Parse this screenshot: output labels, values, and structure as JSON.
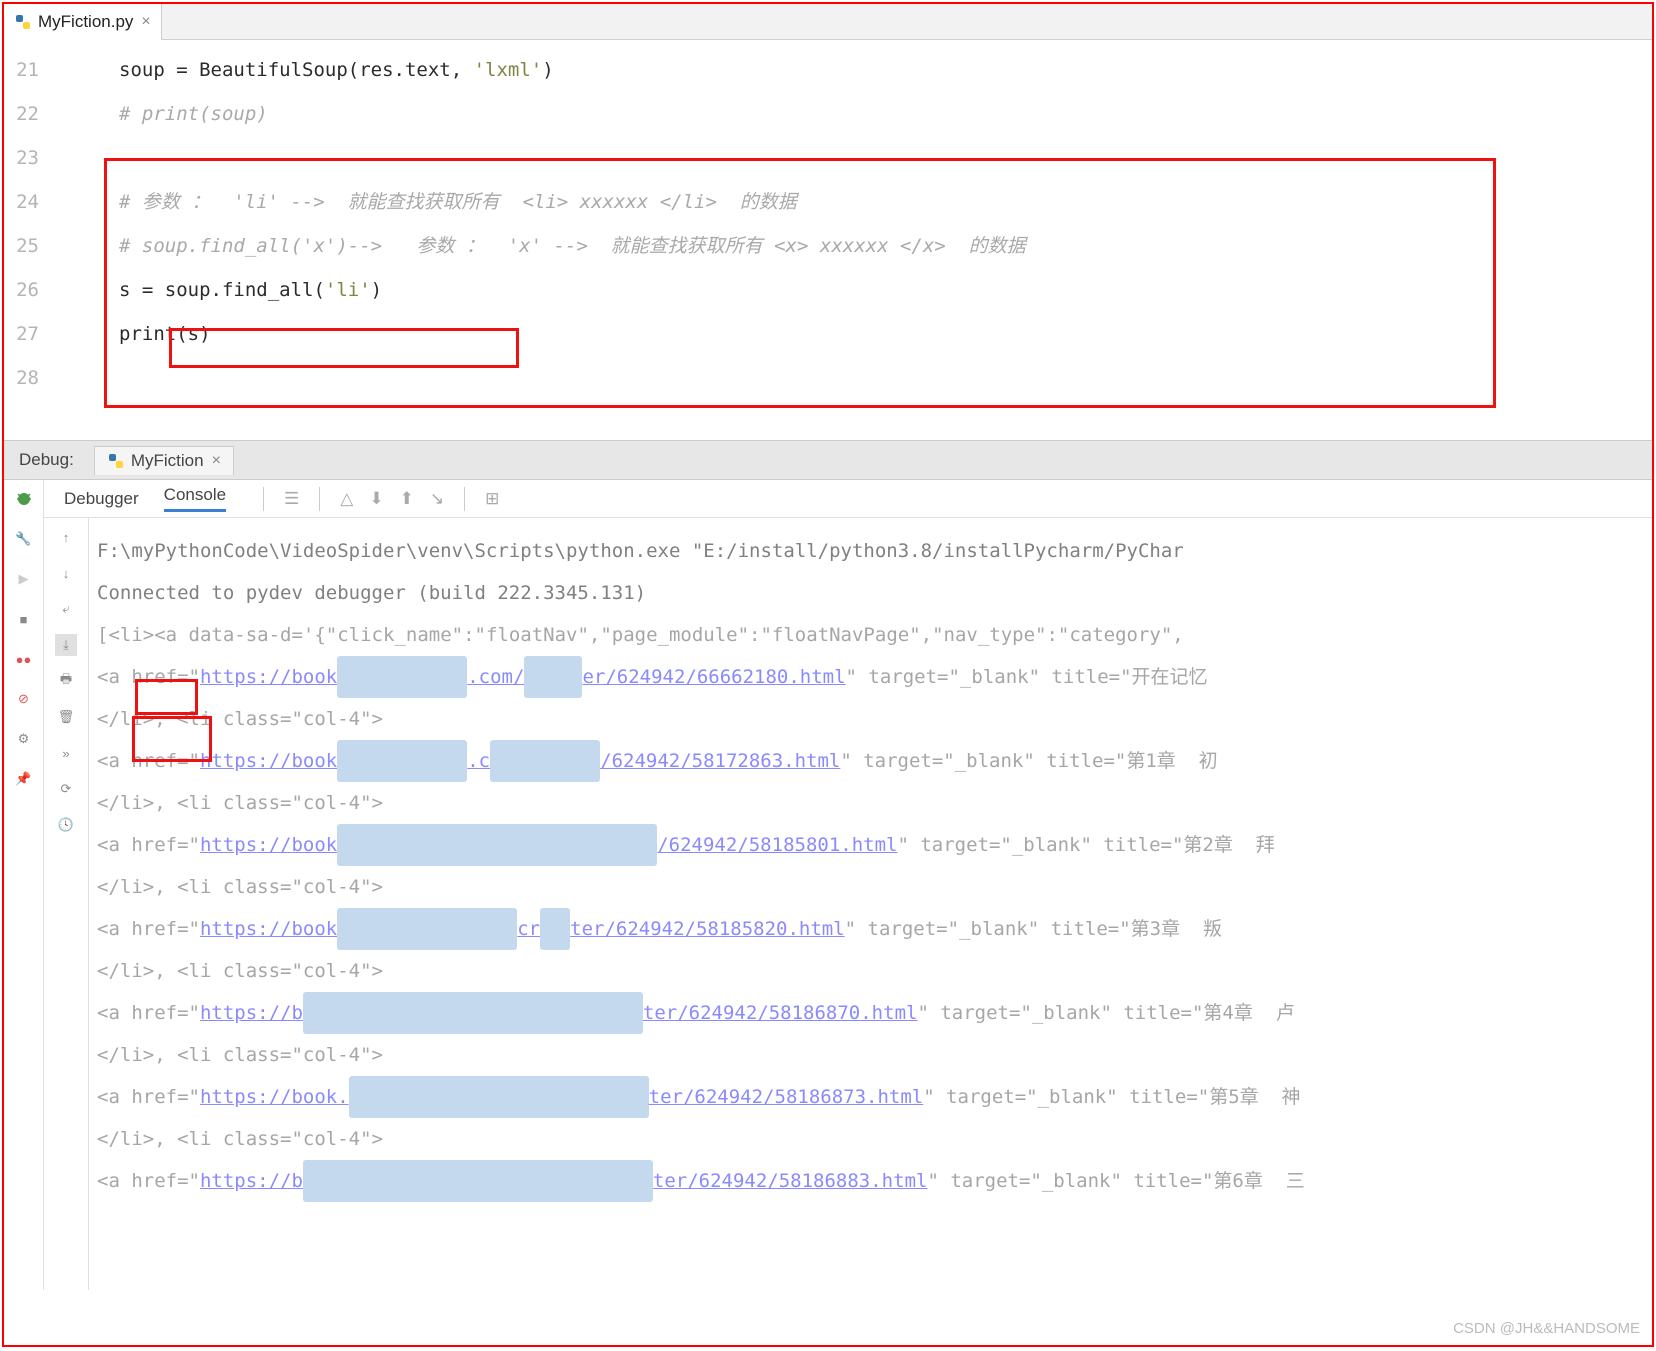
{
  "file_tab": {
    "name": "MyFiction.py"
  },
  "gutter": [
    "21",
    "22",
    "23",
    "24",
    "25",
    "26",
    "27",
    "28"
  ],
  "code": {
    "l21_pre": "soup = BeautifulSoup(res.text, ",
    "l21_str": "'lxml'",
    "l21_post": ")",
    "l22": "# print(soup)",
    "l24": "# 参数 ：  'li' -->  就能查找获取所有  <li> xxxxxx </li>  的数据",
    "l25": "# soup.find_all('x')-->   参数 ：  'x' -->  就能查找获取所有 <x> xxxxxx </x>  的数据",
    "l26_pre": "s = soup.find_all(",
    "l26_str": "'li'",
    "l26_post": ")",
    "l27_pre": "print",
    "l27_post": "(s)"
  },
  "debug": {
    "label": "Debug:",
    "tab": "MyFiction",
    "inner_tabs": {
      "debugger": "Debugger",
      "console": "Console"
    }
  },
  "console": {
    "l1a": "F:\\myPythonCode\\VideoSpider\\venv\\Scripts\\python.exe ",
    "l1b": "\"E:/install/python3.8/installPycharm/PyChar",
    "l2": "Connected to pydev debugger (build 222.3345.131)",
    "l3a": "[",
    "l3b": "<li>",
    "l3c": "<a data-sa-d='{\"click_name\":\"floatNav\",\"page_module\":\"floatNavPage\",\"nav_type\":\"category\",",
    "l4a": "<a href=\"",
    "l4url1": "https://book",
    "l4url2": ".com/",
    "l4url3": "er/624942/66662180.html",
    "l4b": "\" target=\"_blank\" title=\"开在记忆",
    "l5a": "</li>",
    "l5b": ", <li class=\"col-4\">",
    "l6a": "<a href=\"",
    "l6url1": "https://book",
    "l6url2": ".c",
    "l6url3": "/624942/58172863.html",
    "l6b": "\" target=\"_blank\" title=\"第1章  初",
    "l7": "</li>, <li class=\"col-4\">",
    "l8a": "<a href=\"",
    "l8url1": "https://book",
    "l8url2": "/624942/58185801.html",
    "l8b": "\" target=\"_blank\" title=\"第2章  拜",
    "l9": "</li>, <li class=\"col-4\">",
    "l10a": "<a href=\"",
    "l10url1": "https://book",
    "l10url2": "cr",
    "l10url3": "ter/624942/58185820.html",
    "l10b": "\" target=\"_blank\" title=\"第3章  叛",
    "l11": "</li>, <li class=\"col-4\">",
    "l12a": "<a href=\"",
    "l12url1": "https://b",
    "l12url2": "ter/624942/58186870.html",
    "l12b": "\" target=\"_blank\" title=\"第4章  卢",
    "l13": "</li>, <li class=\"col-4\">",
    "l14a": "<a href=\"",
    "l14url1": "https://book.",
    "l14url2": "ter/624942/58186873.html",
    "l14b": "\" target=\"_blank\" title=\"第5章  神",
    "l15": "</li>, <li class=\"col-4\">",
    "l16a": "<a href=\"",
    "l16url1": "https://b",
    "l16url2": "ter/624942/58186883.html",
    "l16b": "\" target=\"_blank\" title=\"第6章  三"
  },
  "watermark": "CSDN @JH&&HANDSOME"
}
